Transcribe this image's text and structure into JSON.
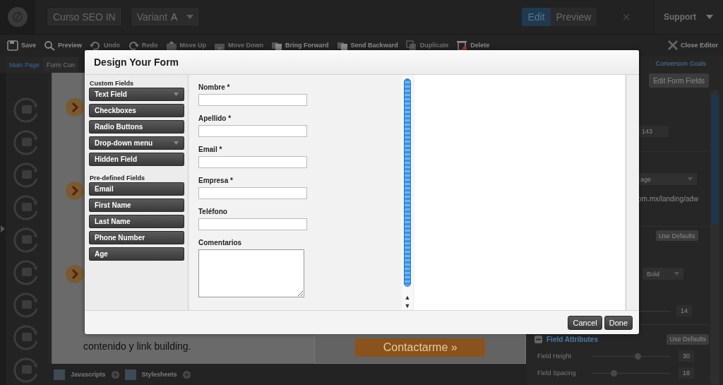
{
  "top_bar": {
    "page_name": "Curso SEO IN",
    "variant": {
      "label": "Variant",
      "value": "A"
    },
    "modes": [
      {
        "label": "Edit",
        "selected": true
      },
      {
        "label": "Preview",
        "selected": false
      }
    ],
    "close": "×",
    "support": "Support"
  },
  "toolbar": [
    {
      "label": "Save",
      "disabled": false
    },
    {
      "label": "Preview",
      "disabled": false
    },
    {
      "label": "Undo",
      "disabled": true
    },
    {
      "label": "Redo",
      "disabled": true
    },
    {
      "label": "Move Up",
      "disabled": true
    },
    {
      "label": "Move Down",
      "disabled": true
    },
    {
      "label": "Bring Forward",
      "disabled": false
    },
    {
      "label": "Send Backward",
      "disabled": false
    },
    {
      "label": "Duplicate",
      "disabled": true
    },
    {
      "label": "Delete",
      "disabled": false
    }
  ],
  "close_editor": "Close Editor",
  "page_tabs": [
    {
      "label": "Main Page",
      "selected": true
    },
    {
      "label": "Form Con",
      "selected": false
    }
  ],
  "canvas": {
    "text": "contenido y link building.",
    "cta": "Contactarme »"
  },
  "assets_bar": [
    "Javascripts",
    "Stylesheets"
  ],
  "dialog_scroll": {
    "up": "▲",
    "down": "▼"
  },
  "right_panel": {
    "tab": "Conversion Goals",
    "edit_button": "Edit Form Fields",
    "height_value": "143",
    "page_select": "age",
    "url": "om.mx/landing/adw",
    "defaults_button": "Use Defaults",
    "weight_select": "Bold",
    "size_value": "14",
    "section": {
      "title": "Field Attributes",
      "expanded": true,
      "defaults_button": "Use Defaults"
    },
    "sliders": [
      {
        "label": "Field Height",
        "level": 0.58,
        "value": "30"
      },
      {
        "label": "Field Spacing",
        "level": 0.27,
        "value": "18"
      }
    ]
  },
  "dialog": {
    "title": "Design Your Form",
    "custom_fields": {
      "heading": "Custom Fields",
      "items": [
        {
          "label": "Text Field",
          "has_menu": true
        },
        {
          "label": "Checkboxes",
          "has_menu": false
        },
        {
          "label": "Radio Buttons",
          "has_menu": false
        },
        {
          "label": "Drop-down menu",
          "has_menu": true
        },
        {
          "label": "Hidden Field",
          "has_menu": false
        }
      ]
    },
    "predefined_fields": {
      "heading": "Pre-defined Fields",
      "items": [
        {
          "label": "Email",
          "has_menu": false
        },
        {
          "label": "First Name",
          "has_menu": false
        },
        {
          "label": "Last Name",
          "has_menu": false
        },
        {
          "label": "Phone Number",
          "has_menu": false
        },
        {
          "label": "Age",
          "has_menu": false
        }
      ]
    },
    "form": [
      {
        "label": "Nombre *",
        "kind": "input"
      },
      {
        "label": "Apellido *",
        "kind": "input"
      },
      {
        "label": "Email *",
        "kind": "input"
      },
      {
        "label": "Empresa *",
        "kind": "input"
      },
      {
        "label": "Teléfono",
        "kind": "input"
      },
      {
        "label": "Comentarios",
        "kind": "textarea"
      }
    ],
    "buttons": [
      "Cancel",
      "Done"
    ]
  }
}
